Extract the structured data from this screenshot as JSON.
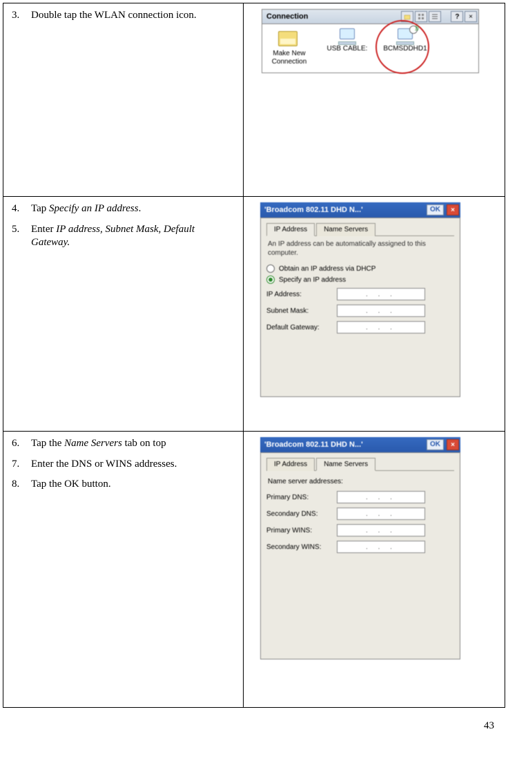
{
  "pageNumber": "43",
  "rows": [
    {
      "steps": [
        {
          "n": "3.",
          "html": "Double tap the WLAN connection icon."
        }
      ]
    },
    {
      "steps": [
        {
          "n": "4.",
          "html": "Tap <span class=\"italic\">Specify an IP address</span>."
        },
        {
          "n": "5.",
          "html": "Enter <span class=\"italic\">IP address, Subnet Mask, Default Gateway.</span>"
        }
      ]
    },
    {
      "steps": [
        {
          "n": "6.",
          "html": "Tap the <span class=\"italic\">Name Servers</span> tab on top"
        },
        {
          "n": "7.",
          "html": "Enter the DNS or WINS addresses."
        },
        {
          "n": "8.",
          "html": "Tap the OK button."
        }
      ]
    }
  ],
  "screenshot1": {
    "windowTitle": "Connection",
    "items": [
      {
        "label": "Make New Connection"
      },
      {
        "label": "USB CABLE:"
      },
      {
        "label": "BCMSDDHD1"
      }
    ]
  },
  "screenshot2": {
    "title": "'Broadcom 802.11 DHD N...'",
    "ok": "OK",
    "tabs": {
      "ip": "IP Address",
      "ns": "Name Servers"
    },
    "hint": "An IP address can be automatically assigned to this computer.",
    "radio1": "Obtain an IP address via DHCP",
    "radio2": "Specify an IP address",
    "fields": {
      "ip": "IP Address:",
      "mask": "Subnet Mask:",
      "gw": "Default Gateway:"
    }
  },
  "screenshot3": {
    "title": "'Broadcom 802.11 DHD N...'",
    "ok": "OK",
    "tabs": {
      "ip": "IP Address",
      "ns": "Name Servers"
    },
    "heading": "Name server addresses:",
    "fields": {
      "pdns": "Primary DNS:",
      "sdns": "Secondary DNS:",
      "pwins": "Primary WINS:",
      "swins": "Secondary WINS:"
    }
  }
}
